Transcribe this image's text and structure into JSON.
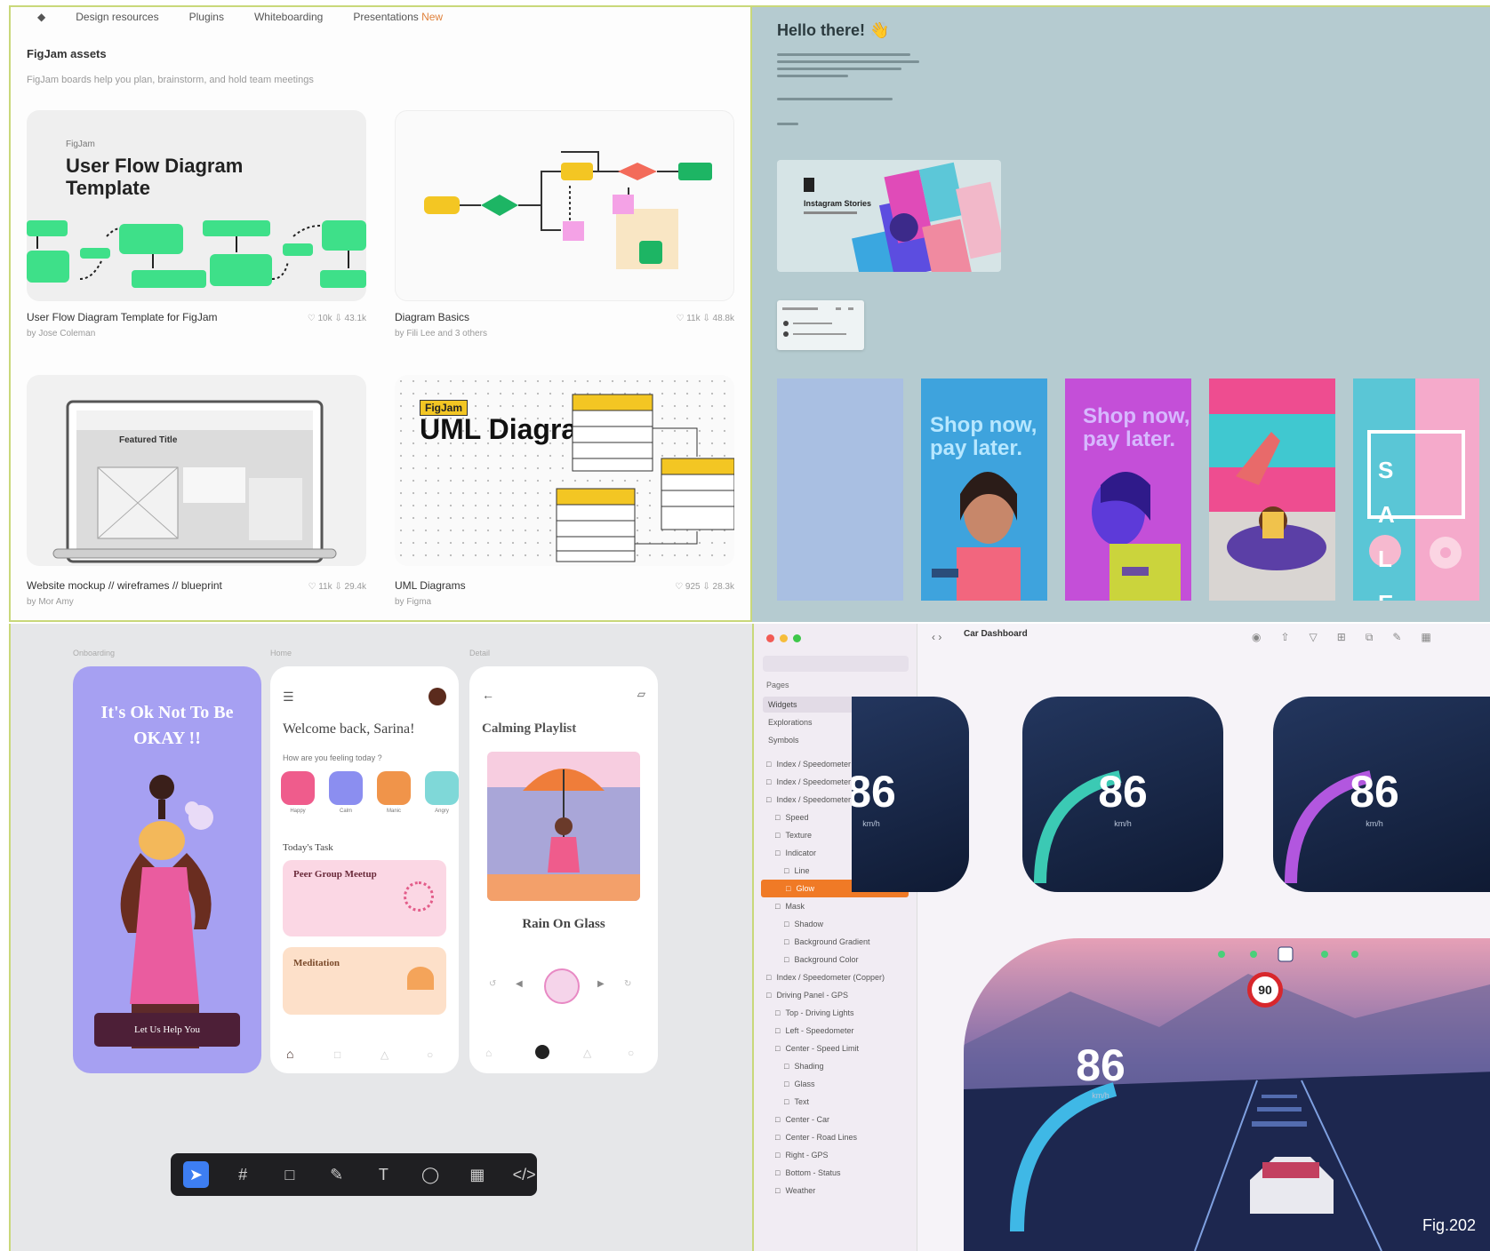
{
  "figjam": {
    "nav": [
      "Design resources",
      "Plugins",
      "Whiteboarding",
      "Presentations"
    ],
    "nav_badge": "New",
    "heading": "FigJam assets",
    "subheading": "FigJam boards help you plan, brainstorm, and hold team meetings",
    "cards": [
      {
        "thumb_small": "FigJam",
        "thumb_title": "User Flow Diagram Template",
        "title": "User Flow Diagram Template for FigJam",
        "by": "by Jose Coleman",
        "stats": "♡ 10k   ⇩ 43.1k"
      },
      {
        "title": "Diagram Basics",
        "by": "by Fili Lee and 3 others",
        "stats": "♡ 11k   ⇩ 48.8k"
      },
      {
        "thumb_title": "Featured Title",
        "title": "Website mockup // wireframes // blueprint",
        "by": "by Mor Amy",
        "stats": "♡ 11k   ⇩ 29.4k"
      },
      {
        "thumb_tag": "FigJam",
        "thumb_title": "UML Diagram",
        "title": "UML Diagrams",
        "by": "by Figma",
        "stats": "♡ 925   ⇩ 28.3k"
      }
    ]
  },
  "instagram": {
    "greeting": "Hello there! 👋",
    "card_title": "Instagram Stories",
    "stories": [
      {
        "text": ""
      },
      {
        "text": "Shop now, pay later."
      },
      {
        "text": "Shop now, pay later."
      },
      {
        "text": ""
      },
      {
        "text": "S A L E"
      }
    ]
  },
  "mobile": {
    "labels": [
      "Onboarding",
      "Home",
      "Detail"
    ],
    "onboarding_title": "It's Ok Not To Be OKAY !!",
    "onboarding_button": "Let Us Help You",
    "home_greeting": "Welcome back, Sarina!",
    "home_question": "How are you feeling today ?",
    "home_moods": [
      "Happy",
      "Calm",
      "Manic",
      "Angry"
    ],
    "home_task_heading": "Today's Task",
    "home_task1": "Peer Group Meetup",
    "home_task2": "Meditation",
    "detail_title": "Calming Playlist",
    "track_title": "Rain On Glass"
  },
  "dashboard": {
    "file_title": "Car Dashboard",
    "pages_label": "Pages",
    "pages": [
      "Widgets",
      "Explorations",
      "Symbols"
    ],
    "layers": [
      "Index / Speedometer (Blue)",
      "Index / Speedometer (Green)",
      "Index / Speedometer (Purple)",
      "Speed",
      "Texture",
      "Indicator",
      "Line",
      "Glow",
      "Mask",
      "Shadow",
      "Background Gradient",
      "Background Color",
      "Index / Speedometer (Copper)",
      "Driving Panel - GPS",
      "Top - Driving Lights",
      "Left - Speedometer",
      "Center - Speed Limit",
      "Shading",
      "Glass",
      "Text",
      "Center - Car",
      "Center - Road Lines",
      "Right - GPS",
      "Bottom - Status",
      "Weather"
    ],
    "selected_layer": 7,
    "speed_value": "86",
    "speed_unit": "km/h",
    "speed_limit": "90",
    "figure_label": "Fig.202",
    "accent": "#f07a26"
  }
}
